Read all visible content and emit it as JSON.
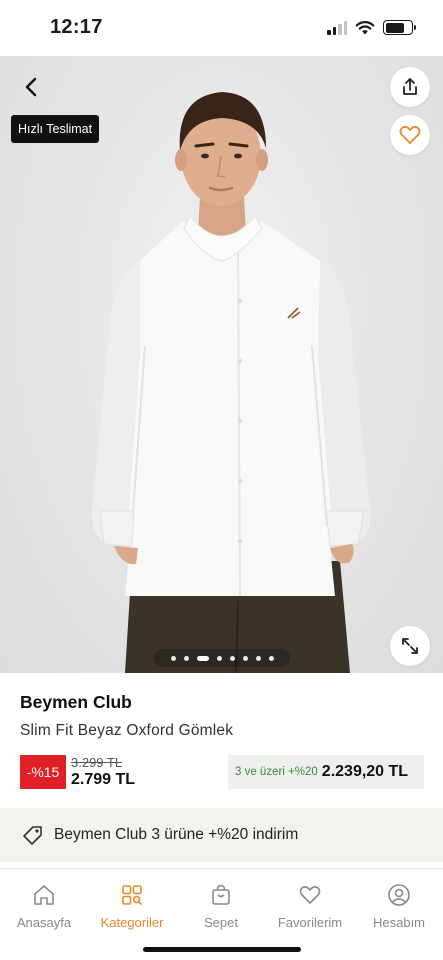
{
  "status_bar": {
    "time": "12:17",
    "battery_level": 0.75,
    "signal_bars_active": 2,
    "icons": [
      "cellular-signal-icon",
      "wifi-icon",
      "battery-icon"
    ]
  },
  "product_image": {
    "badge": "Hızlı Teslimat",
    "carousel_total": 8,
    "carousel_active_index": 2,
    "icons": [
      "back-arrow-icon",
      "share-icon",
      "heart-icon",
      "expand-icon"
    ]
  },
  "product": {
    "brand": "Beymen Club",
    "name": "Slim Fit Beyaz Oxford Gömlek",
    "discount_badge": "-%15",
    "old_price": "3.299 TL",
    "price": "2.799 TL",
    "bundle_label": "3 ve üzeri +%20",
    "bundle_price": "2.239,20 TL"
  },
  "promo": {
    "text": "Beymen Club 3 ürüne +%20 indirim",
    "icon": "tag-icon"
  },
  "bottom_nav": {
    "items": [
      {
        "label": "Anasayfa",
        "icon": "home-icon"
      },
      {
        "label": "Kategoriler",
        "icon": "categories-icon"
      },
      {
        "label": "Sepet",
        "icon": "bag-icon"
      },
      {
        "label": "Favorilerim",
        "icon": "heart-icon"
      },
      {
        "label": "Hesabım",
        "icon": "account-icon"
      }
    ],
    "active_index": 1
  },
  "colors": {
    "accent": "#e8892a",
    "discount": "#e11f26",
    "bundle_text": "#3a8a3a"
  }
}
